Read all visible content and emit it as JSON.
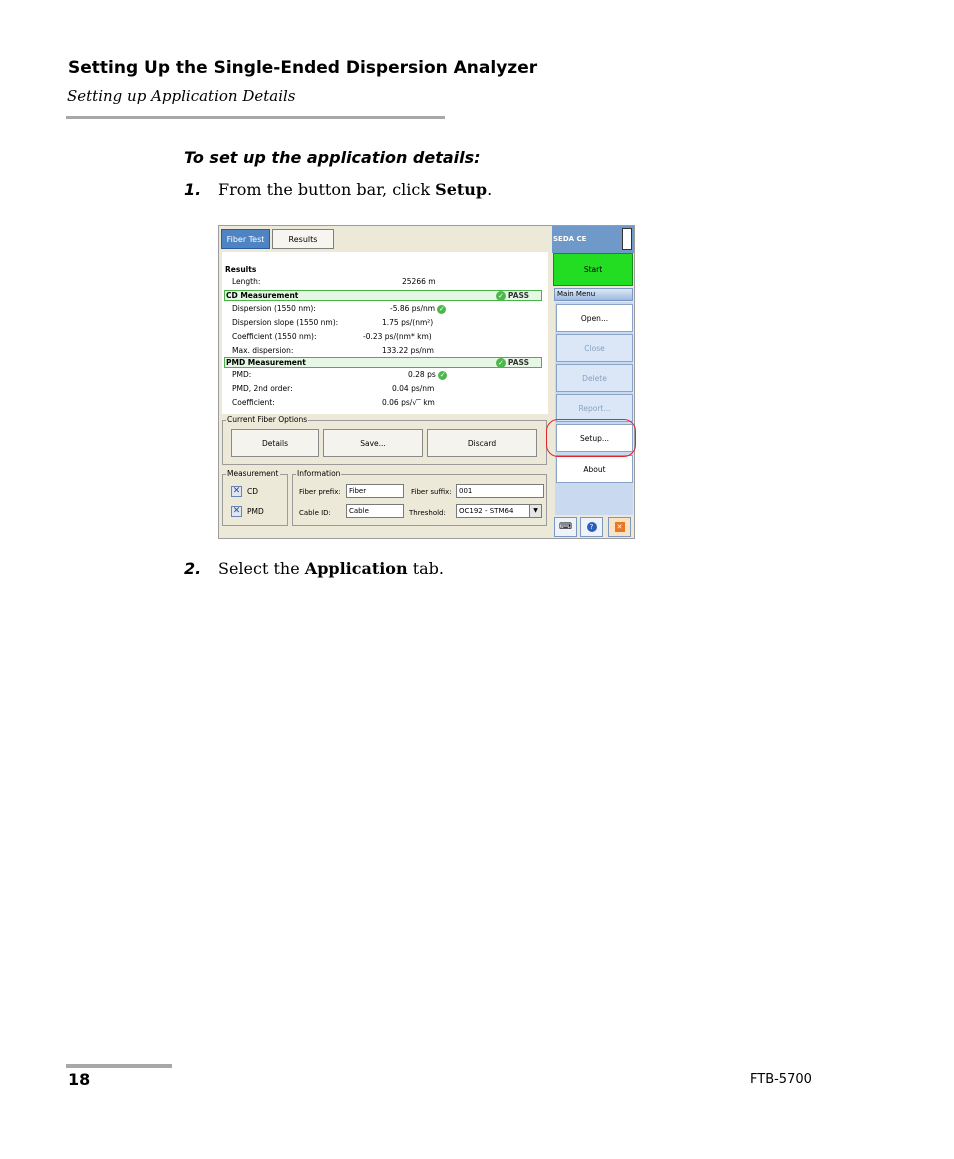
{
  "header": {
    "title": "Setting Up the Single-Ended Dispersion Analyzer",
    "subtitle": "Setting up Application Details"
  },
  "procedure": {
    "heading": "To set up the application details:",
    "steps": [
      {
        "num": "1.",
        "text_before": "From the button bar, click ",
        "bold": "Setup",
        "text_after": "."
      },
      {
        "num": "2.",
        "text_before": "Select the ",
        "bold": "Application",
        "text_after": " tab."
      }
    ]
  },
  "screenshot": {
    "tabs": [
      "Fiber Test",
      "Results"
    ],
    "results_title": "Results",
    "length": {
      "label": "Length:",
      "value": "25266 m"
    },
    "cd": {
      "title": "CD Measurement",
      "status": "PASS",
      "rows": [
        {
          "label": "Dispersion (1550 nm):",
          "value": "-5.86 ps/nm"
        },
        {
          "label": "Dispersion slope (1550 nm):",
          "value": "1.75 ps/(nm²)"
        },
        {
          "label": "Coefficient (1550 nm):",
          "value": "-0.23 ps/(nm* km)"
        },
        {
          "label": "Max. dispersion:",
          "value": "133.22 ps/nm"
        }
      ]
    },
    "pmd": {
      "title": "PMD Measurement",
      "status": "PASS",
      "rows": [
        {
          "label": "PMD:",
          "value": "0.28 ps"
        },
        {
          "label": "PMD, 2nd order:",
          "value": "0.04 ps/nm"
        },
        {
          "label": "Coefficient:",
          "value": "0.06 ps/√‾ km"
        }
      ]
    },
    "fiber_options": {
      "label": "Current Fiber Options",
      "buttons": [
        "Details",
        "Save...",
        "Discard"
      ]
    },
    "measurement": {
      "label": "Measurement",
      "items": [
        "CD",
        "PMD"
      ]
    },
    "information": {
      "label": "Information",
      "fiber_prefix_label": "Fiber prefix:",
      "fiber_prefix": "Fiber",
      "fiber_suffix_label": "Fiber suffix:",
      "fiber_suffix": "001",
      "cable_id_label": "Cable ID:",
      "cable_id": "Cable",
      "threshold_label": "Threshold:",
      "threshold": "OC192 - STM64"
    },
    "side": {
      "app_name": "SEDA CE",
      "start": "Start",
      "menu_title": "Main Menu",
      "menu": [
        "Open...",
        "Close",
        "Delete",
        "Report...",
        "Setup...",
        "About"
      ]
    }
  },
  "footer": {
    "page": "18",
    "model": "FTB-5700"
  }
}
